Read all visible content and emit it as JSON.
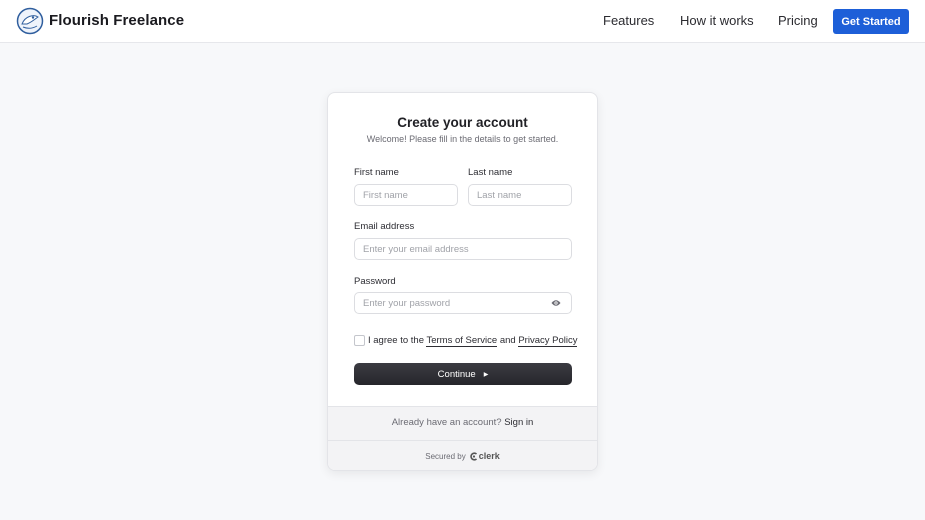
{
  "header": {
    "brand": "Flourish Freelance",
    "nav": {
      "features": "Features",
      "how_it_works": "How it works",
      "pricing": "Pricing"
    },
    "cta": "Get Started",
    "cta_color": "#1d5fd8"
  },
  "card": {
    "title": "Create your account",
    "subtitle": "Welcome! Please fill in the details to get started.",
    "first_name": {
      "label": "First name",
      "placeholder": "First name"
    },
    "last_name": {
      "label": "Last name",
      "placeholder": "Last name"
    },
    "email": {
      "label": "Email address",
      "placeholder": "Enter your email address"
    },
    "password": {
      "label": "Password",
      "placeholder": "Enter your password"
    },
    "terms": {
      "prefix": "I agree to the",
      "tos": "Terms of Service",
      "and": "and",
      "privacy": "Privacy Policy"
    },
    "continue_label": "Continue",
    "footer": {
      "already": "Already have an account?",
      "signin": "Sign in",
      "secured_by": "Secured by",
      "provider": "clerk"
    }
  }
}
